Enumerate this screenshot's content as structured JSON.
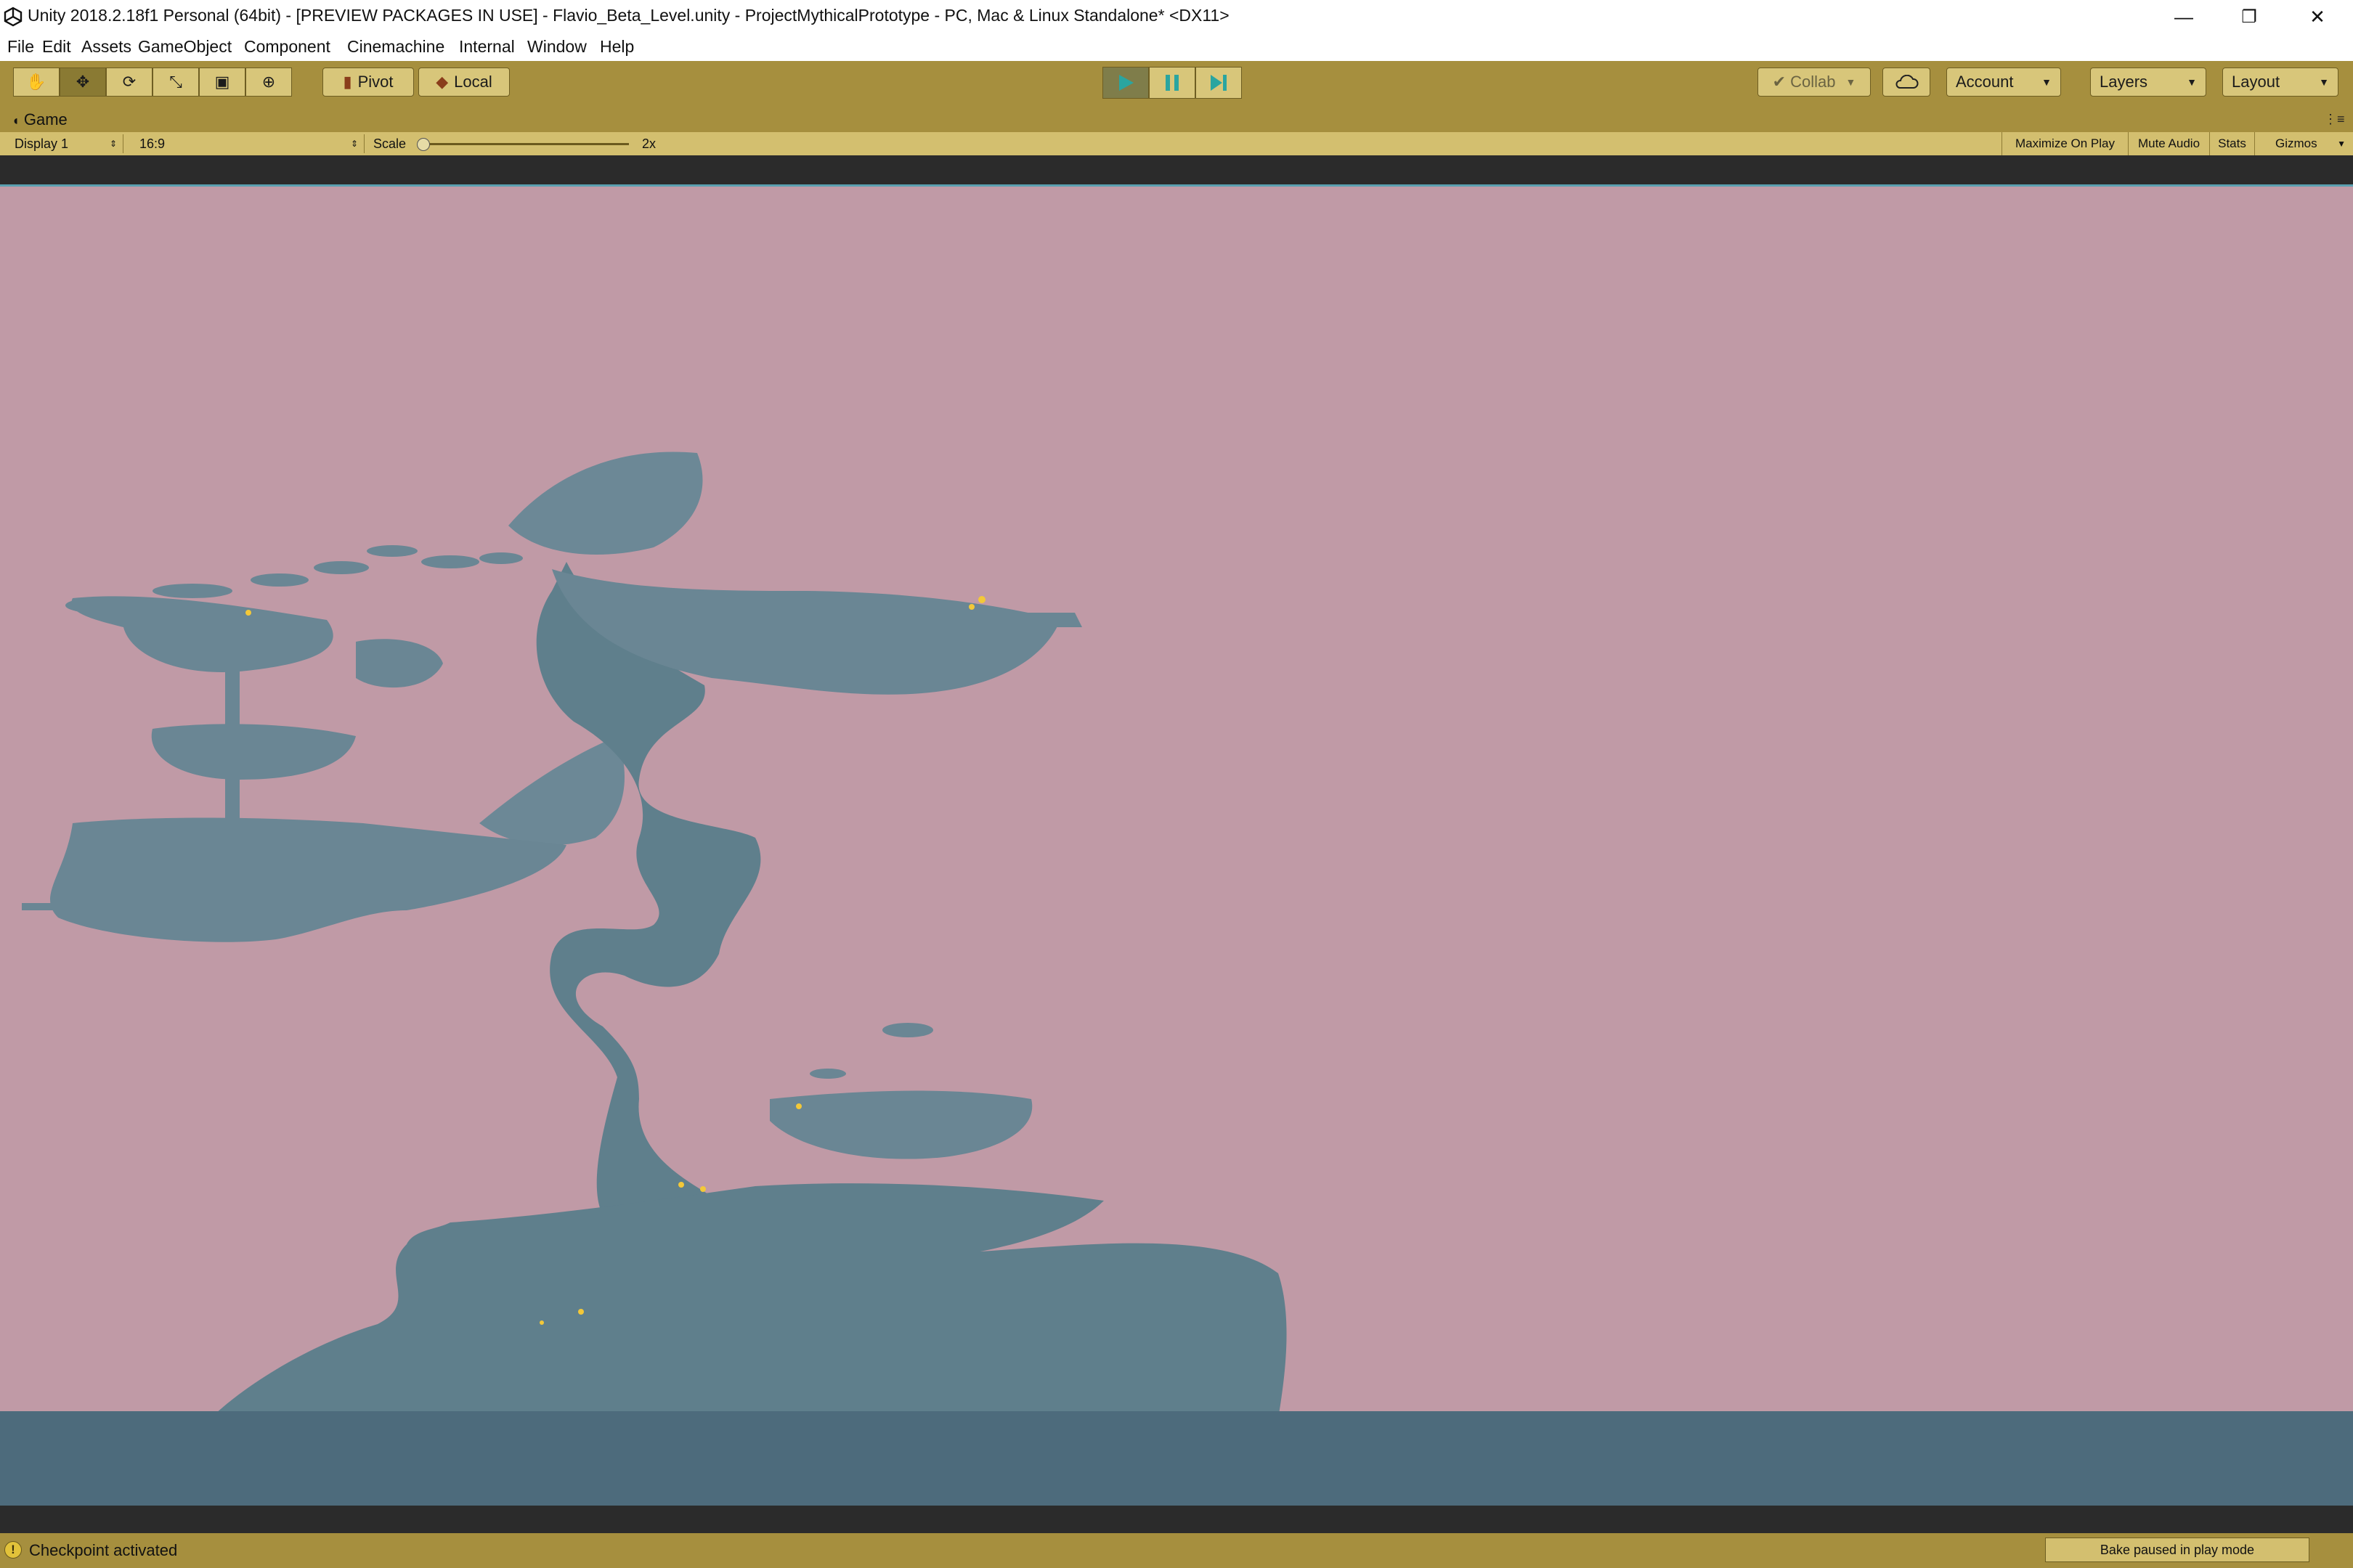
{
  "window": {
    "title": "Unity 2018.2.18f1 Personal (64bit) - [PREVIEW PACKAGES IN USE] - Flavio_Beta_Level.unity - ProjectMythicalPrototype - PC, Mac & Linux Standalone* <DX11>",
    "controls": {
      "minimize": "—",
      "restore": "❐",
      "close": "✕"
    }
  },
  "menu": [
    "File",
    "Edit",
    "Assets",
    "GameObject",
    "Component",
    "Cinemachine",
    "Internal",
    "Window",
    "Help"
  ],
  "toolbar": {
    "tools": [
      {
        "icon": "hand-icon",
        "glyph": "✋",
        "active": false
      },
      {
        "icon": "move-icon",
        "glyph": "✥",
        "active": true
      },
      {
        "icon": "rotate-icon",
        "glyph": "⟳",
        "active": false
      },
      {
        "icon": "scale-icon",
        "glyph": "⤡",
        "active": false
      },
      {
        "icon": "rect-icon",
        "glyph": "▣",
        "active": false
      },
      {
        "icon": "transform-icon",
        "glyph": "⊕",
        "active": false
      }
    ],
    "pivot_label": "Pivot",
    "local_label": "Local",
    "collab_label": "Collab",
    "account_label": "Account",
    "layers_label": "Layers",
    "layout_label": "Layout",
    "play_active": true
  },
  "game_panel": {
    "tab_label": "Game",
    "display": "Display 1",
    "aspect": "16:9",
    "scale_label": "Scale",
    "scale_value": "2x",
    "buttons": [
      "Maximize On Play",
      "Mute Audio",
      "Stats",
      "Gizmos"
    ]
  },
  "status": {
    "message": "Checkpoint activated",
    "bake": "Bake paused in play mode"
  },
  "colors": {
    "sky": "#c09aa6",
    "silhouette": "#5f7f8c",
    "ground": "#4d6b7c",
    "toolbar": "#a68f3e",
    "play_accent": "#2aa5a0"
  }
}
